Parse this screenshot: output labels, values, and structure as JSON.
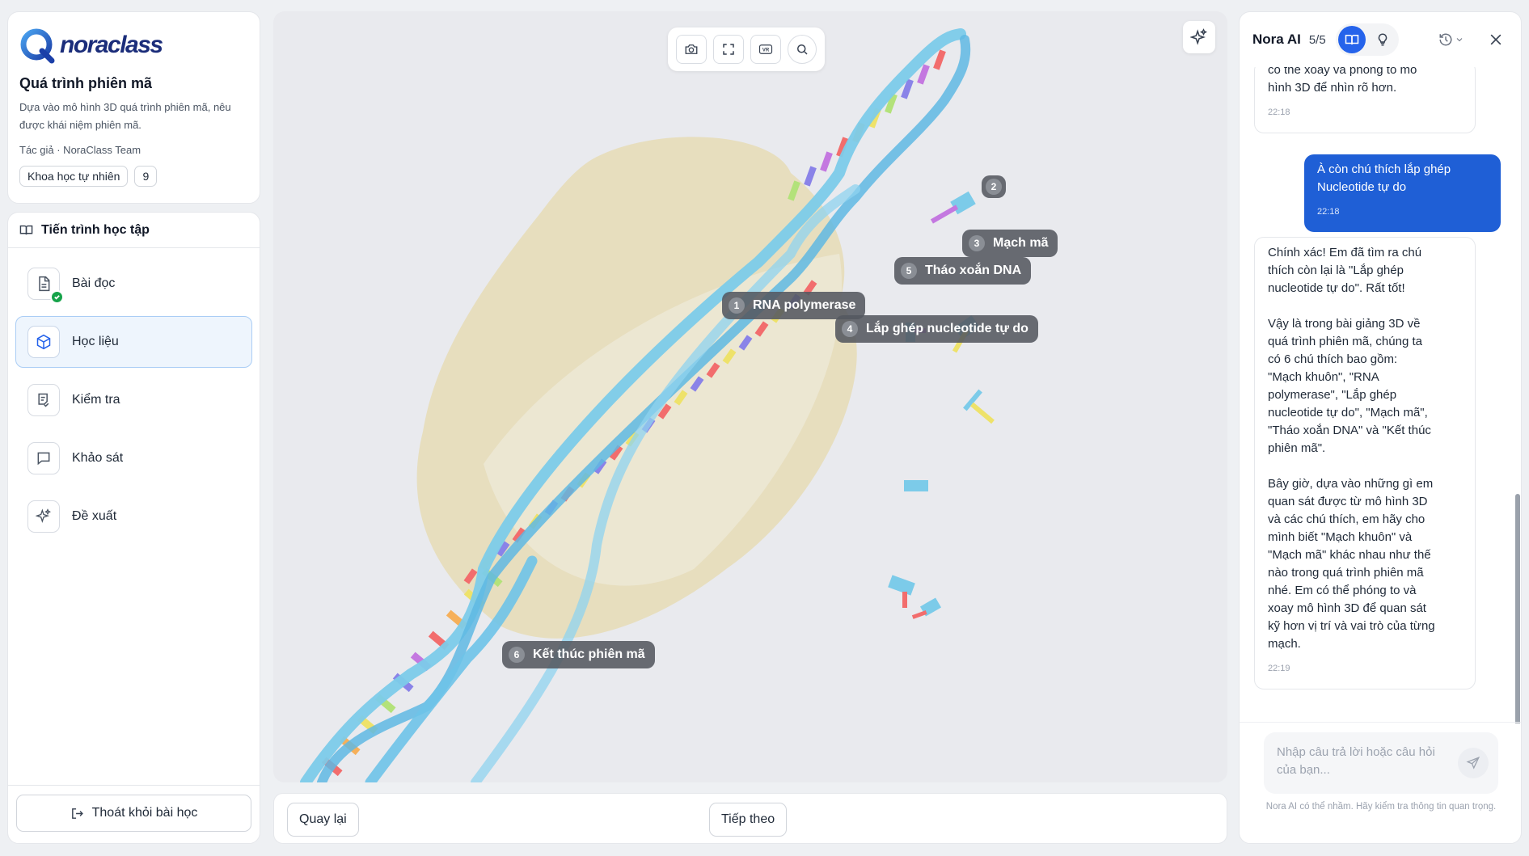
{
  "brand": {
    "logo_text": "noraclass"
  },
  "course": {
    "title": "Quá trình phiên mã",
    "description": "Dựa vào mô hình 3D quá trình phiên mã, nêu được khái niệm phiên mã.",
    "author": "Tác giả · NoraClass Team",
    "tag": "Khoa học tự nhiên",
    "grade": "9"
  },
  "progress": {
    "title": "Tiến trình học tập",
    "items": [
      {
        "label": "Bài đọc",
        "icon": "document-icon",
        "completed": true
      },
      {
        "label": "Học liệu",
        "icon": "cube-icon",
        "active": true
      },
      {
        "label": "Kiểm tra",
        "icon": "checklist-icon"
      },
      {
        "label": "Khảo sát",
        "icon": "chat-bubble-icon"
      },
      {
        "label": "Đề xuất",
        "icon": "sparkles-icon"
      }
    ],
    "exit_label": "Thoát khỏi bài học"
  },
  "viewer": {
    "tools": [
      "camera-icon",
      "fullscreen-icon",
      "vr-icon",
      "search-icon"
    ],
    "vr_text": "VR",
    "labels": [
      {
        "num": "1",
        "text": "RNA polymerase"
      },
      {
        "num": "2",
        "text": ""
      },
      {
        "num": "3",
        "text": "Mạch mã"
      },
      {
        "num": "4",
        "text": "Lắp ghép nucleotide tự do"
      },
      {
        "num": "5",
        "text": "Tháo xoắn DNA"
      },
      {
        "num": "6",
        "text": "Kết thúc phiên mã"
      }
    ],
    "colors": {
      "helix": "#7ccbe9",
      "enzyme": "#e9dfb8",
      "bases": [
        "#f26d6d",
        "#f6b05a",
        "#eee26a",
        "#b3e27a",
        "#8a83e8",
        "#c478e0"
      ]
    }
  },
  "footer": {
    "back_label": "Quay lại",
    "next_label": "Tiếp theo"
  },
  "chat": {
    "title": "Nora AI",
    "count": "5/5",
    "messages": [
      {
        "role": "ai",
        "lines": [
          "có thể xoay và phóng to mô",
          "hình 3D để nhìn rõ hơn."
        ],
        "time": "22:18"
      },
      {
        "role": "user",
        "lines": [
          "À còn chú thích lắp ghép",
          "Nucleotide tự do"
        ],
        "time": "22:18"
      },
      {
        "role": "ai",
        "lines": [
          "Chính xác! Em đã tìm ra chú",
          "thích còn lại là \"Lắp ghép",
          "nucleotide tự do\". Rất tốt!",
          "",
          "Vậy là trong bài giảng 3D về",
          "quá trình phiên mã, chúng ta",
          "có 6 chú thích bao gồm:",
          "\"Mạch khuôn\", \"RNA",
          "polymerase\", \"Lắp ghép",
          "nucleotide tự do\", \"Mạch mã\",",
          "\"Tháo xoắn DNA\" và \"Kết thúc",
          "phiên mã\".",
          "",
          "Bây giờ, dựa vào những gì em",
          "quan sát được từ mô hình 3D",
          "và các chú thích, em hãy cho",
          "mình biết \"Mạch khuôn\" và",
          "\"Mạch mã\" khác nhau như thế",
          "nào trong quá trình phiên mã",
          "nhé. Em có thể phóng to và",
          "xoay mô hình 3D để quan sát",
          "kỹ hơn vị trí và vai trò của từng",
          "mạch."
        ],
        "time": "22:19"
      }
    ],
    "input_placeholder": "Nhập câu trả lời hoặc câu hỏi của bạn...",
    "disclaimer": "Nora AI có thể nhầm. Hãy kiểm tra thông tin quan trọng."
  }
}
